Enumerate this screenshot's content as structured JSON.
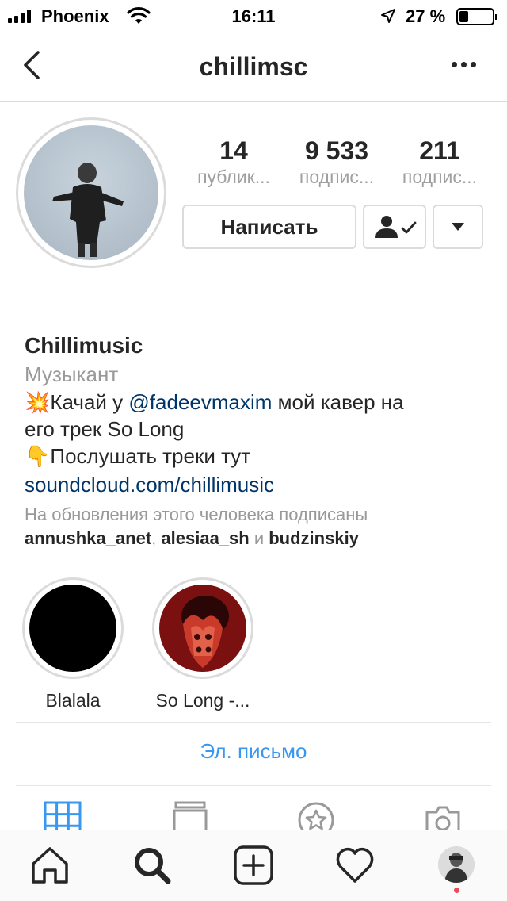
{
  "status_bar": {
    "carrier": "Phoenix",
    "time": "16:11",
    "battery_percent": "27 %",
    "battery_level": 0.27,
    "signal_bars": 4
  },
  "nav": {
    "username": "chillimsc",
    "back_icon": "chevron-left-icon",
    "more_icon": "more-horizontal-icon"
  },
  "stats": [
    {
      "value": "14",
      "label": "публик..."
    },
    {
      "value": "9 533",
      "label": "подпис..."
    },
    {
      "value": "211",
      "label": "подпис..."
    }
  ],
  "actions": {
    "message_label": "Написать",
    "following_icon": "user-check-icon",
    "dropdown_icon": "caret-down-icon"
  },
  "bio": {
    "name": "Chillimusic",
    "category": "Музыкант",
    "line1_emoji": "💥",
    "line1_prefix": "Качай у ",
    "line1_mention": "@fadeevmaxim",
    "line1_suffix": " мой кавер на",
    "line2": "его трек So Long",
    "line3_emoji": "👇",
    "line3_text": "Послушать треки тут",
    "link": "soundcloud.com/chillimusic",
    "followed_by_label": "На обновления этого человека подписаны",
    "followed_by": [
      "annushka_anet",
      "alesiaa_sh",
      "budzinskiy"
    ],
    "separator_comma": ", ",
    "separator_and": " и "
  },
  "highlights": [
    {
      "label": "Blalala"
    },
    {
      "label": "So Long -..."
    }
  ],
  "contact": {
    "email_label": "Эл. письмо"
  },
  "profile_tabs": [
    "grid-icon",
    "feed-list-icon",
    "saved-star-icon",
    "tagged-photo-icon"
  ],
  "tab_bar": [
    "home-icon",
    "search-icon",
    "add-post-icon",
    "heart-icon",
    "profile-avatar"
  ],
  "colors": {
    "link": "#003569",
    "accent_blue": "#3897f0",
    "secondary_text": "#999999",
    "border": "#dbdbdb",
    "notification": "#ed4956"
  }
}
